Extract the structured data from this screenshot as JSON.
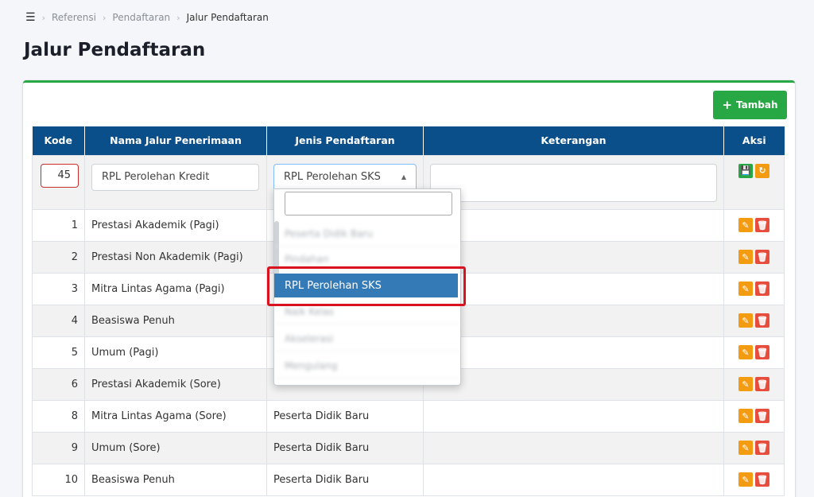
{
  "breadcrumb": {
    "menu_icon": "hamburger-menu-icon",
    "items": [
      "Referensi",
      "Pendaftaran",
      "Jalur Pendaftaran"
    ]
  },
  "page_title": "Jalur Pendaftaran",
  "add_button": {
    "label": "Tambah",
    "icon": "plus-icon"
  },
  "table": {
    "headers": [
      "Kode",
      "Nama Jalur Penerimaan",
      "Jenis Pendaftaran",
      "Keterangan",
      "Aksi"
    ],
    "edit_row": {
      "kode": "45",
      "nama": "RPL Perolehan Kredit",
      "jenis": "RPL Perolehan SKS",
      "keterangan": ""
    },
    "rows": [
      {
        "kode": "1",
        "nama": "Prestasi Akademik (Pagi)",
        "jenis": ""
      },
      {
        "kode": "2",
        "nama": "Prestasi Non Akademik (Pagi)",
        "jenis": ""
      },
      {
        "kode": "3",
        "nama": "Mitra Lintas Agama (Pagi)",
        "jenis": ""
      },
      {
        "kode": "4",
        "nama": "Beasiswa Penuh",
        "jenis": ""
      },
      {
        "kode": "5",
        "nama": "Umum (Pagi)",
        "jenis": ""
      },
      {
        "kode": "6",
        "nama": "Prestasi Akademik (Sore)",
        "jenis": ""
      },
      {
        "kode": "8",
        "nama": "Mitra Lintas Agama (Sore)",
        "jenis": "Peserta Didik Baru"
      },
      {
        "kode": "9",
        "nama": "Umum (Sore)",
        "jenis": "Peserta Didik Baru"
      },
      {
        "kode": "10",
        "nama": "Beasiswa Penuh",
        "jenis": "Peserta Didik Baru"
      }
    ]
  },
  "dropdown": {
    "search_value": "",
    "options": [
      "Peserta Didik Baru",
      "Pindahan",
      "RPL Perolehan SKS",
      "Naik Kelas",
      "Akselerasi",
      "Mengulang"
    ],
    "selected": "RPL Perolehan SKS"
  },
  "colors": {
    "header_bg": "#0b4f8a",
    "accent_green": "#28a745",
    "edit_orange": "#f39c12",
    "delete_red": "#e74c3c",
    "selection_blue": "#337ab7",
    "highlight_red": "#d9121f"
  }
}
